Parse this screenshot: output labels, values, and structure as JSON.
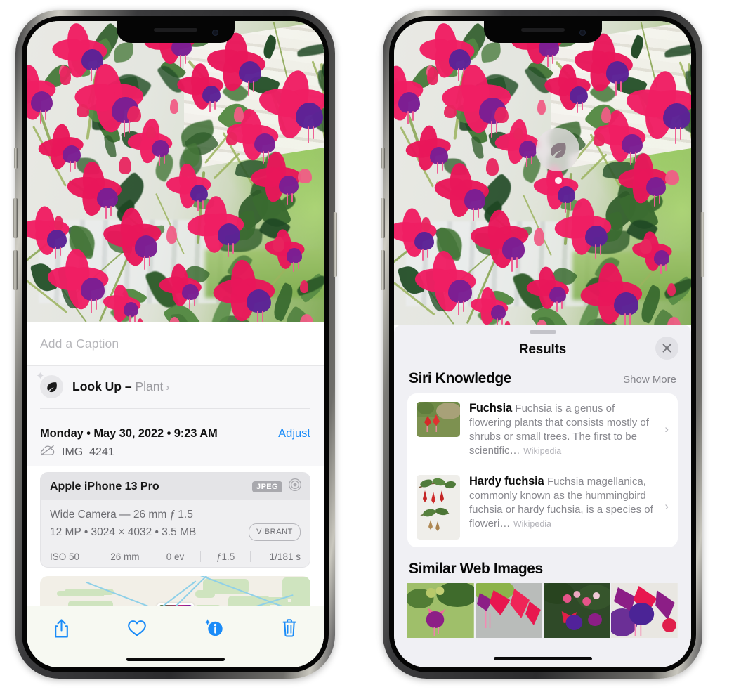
{
  "left_phone": {
    "name": "photos-detail-view",
    "caption_field": {
      "placeholder": "Add a Caption",
      "value": ""
    },
    "lookup": {
      "label": "Look Up – ",
      "subject": "Plant",
      "chevron": "›",
      "icon": "leaf-icon"
    },
    "date_row": {
      "date": "Monday • May 30, 2022 • 9:23 AM",
      "adjust": "Adjust"
    },
    "filename": {
      "icon": "cloud-slash-icon",
      "text": "IMG_4241"
    },
    "metadata": {
      "device": "Apple iPhone 13 Pro",
      "format_badge": "JPEG",
      "lens_icon": "camera-lens-icon",
      "lens_line": "Wide Camera — 26 mm ƒ 1.5",
      "specs_line": "12 MP • 3024 × 4032 • 3.5 MB",
      "vibrant_badge": "VIBRANT",
      "exif": [
        "ISO 50",
        "26 mm",
        "0 ev",
        "ƒ1.5",
        "1/181 s"
      ]
    },
    "map": {
      "name": "location-map-card"
    },
    "toolbar": [
      {
        "name": "share-button",
        "icon": "share-icon"
      },
      {
        "name": "favorite-button",
        "icon": "heart-icon"
      },
      {
        "name": "info-button",
        "icon": "info-sparkle-icon"
      },
      {
        "name": "delete-button",
        "icon": "trash-icon"
      }
    ]
  },
  "right_phone": {
    "name": "visual-lookup-results-view",
    "lookup_badge": {
      "icon": "leaf-icon"
    },
    "sheet": {
      "title": "Results",
      "close": "✕",
      "siri_knowledge": {
        "title": "Siri Knowledge",
        "show_more": "Show More",
        "results": [
          {
            "title": "Fuchsia",
            "description": "Fuchsia is a genus of flowering plants that consists mostly of shrubs or small trees. The first to be scientific…",
            "source": "Wikipedia",
            "chevron": "›"
          },
          {
            "title": "Hardy fuchsia",
            "description": "Fuchsia magellanica, commonly known as the hummingbird fuchsia or hardy fuchsia, is a species of floweri…",
            "source": "Wikipedia",
            "chevron": "›"
          }
        ]
      },
      "similar_web_images": {
        "title": "Similar Web Images",
        "count": 4
      }
    }
  },
  "colors": {
    "accent_blue": "#1b8cf8",
    "sheet_bg": "#f0f0f4",
    "card_bg": "#ffffff",
    "secondary_text": "#88888e",
    "badge_gray": "#a9a9ae"
  }
}
